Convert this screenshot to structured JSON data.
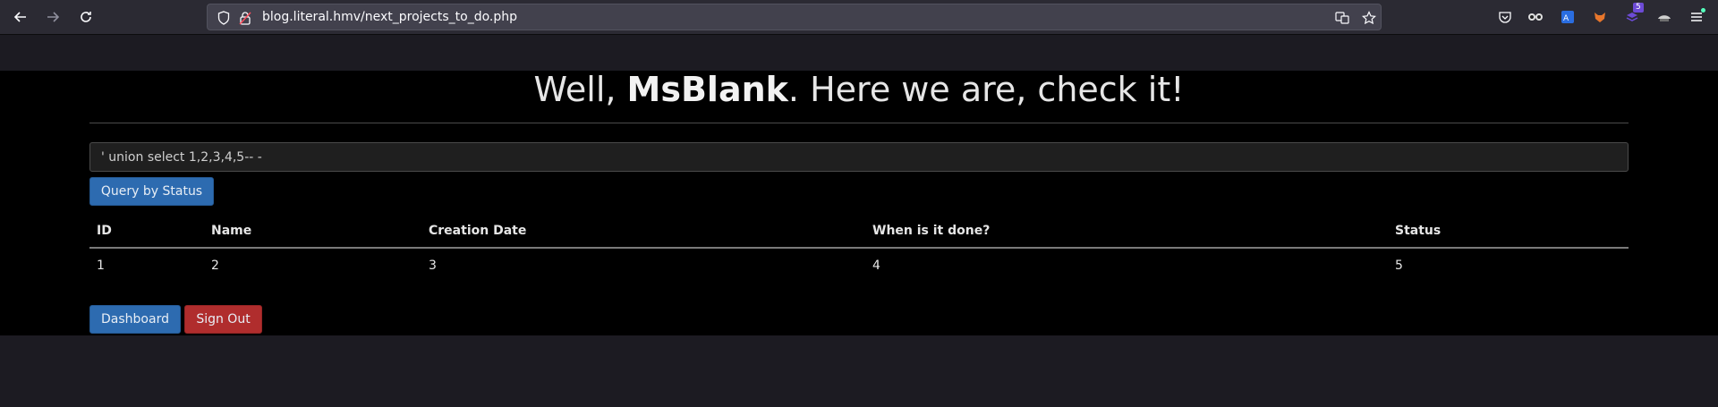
{
  "browser": {
    "url": "blog.literal.hmv/next_projects_to_do.php",
    "badge_count": "5"
  },
  "page": {
    "heading_prefix": "Well, ",
    "heading_user": "MsBlank",
    "heading_suffix": ". Here we are, check it!",
    "search_value": "' union select 1,2,3,4,5-- -",
    "query_button": "Query by Status",
    "table": {
      "headers": [
        "ID",
        "Name",
        "Creation Date",
        "When is it done?",
        "Status"
      ],
      "rows": [
        [
          "1",
          "2",
          "3",
          "4",
          "5"
        ]
      ]
    },
    "dashboard_button": "Dashboard",
    "signout_button": "Sign Out"
  }
}
